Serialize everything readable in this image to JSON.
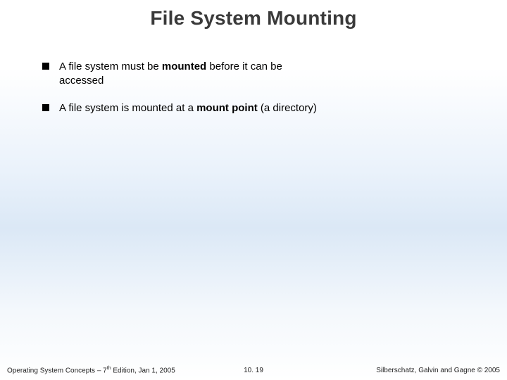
{
  "slide": {
    "title": "File System Mounting",
    "bullets": [
      {
        "pre": "A file system must be ",
        "bold": "mounted",
        "post": " before it can be accessed"
      },
      {
        "pre": "A file system is mounted at a ",
        "bold": "mount point",
        "post": " (a directory)"
      }
    ],
    "footer": {
      "left_pre": "Operating System Concepts – 7",
      "left_sup": "th",
      "left_post": " Edition, Jan 1, 2005",
      "center": "10. 19",
      "right": "Silberschatz, Galvin and Gagne © 2005"
    }
  }
}
